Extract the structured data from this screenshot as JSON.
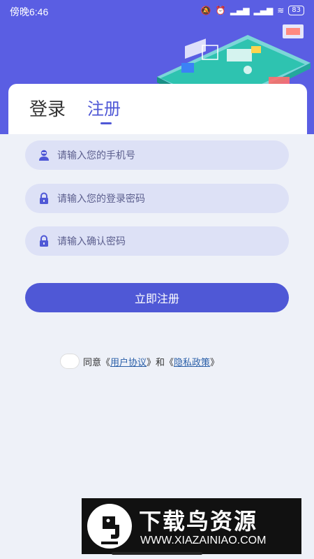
{
  "status_bar": {
    "time": "傍晚6:46",
    "battery": "83",
    "icons": [
      "alarm-off-icon",
      "alarm-icon",
      "hd-signal-icon",
      "hd-signal-icon",
      "wifi-icon",
      "battery-icon"
    ]
  },
  "tabs": {
    "login": "登录",
    "register": "注册",
    "active": "register"
  },
  "form": {
    "phone_placeholder": "请输入您的手机号",
    "password_placeholder": "请输入您的登录密码",
    "confirm_placeholder": "请输入确认密码",
    "submit_label": "立即注册"
  },
  "agreement": {
    "prefix": "同意《",
    "user_agreement": "用户协议",
    "mid": "》和《",
    "privacy_policy": "隐私政策",
    "suffix": "》"
  },
  "watermark": {
    "title": "下载鸟资源",
    "url": "WWW.XIAZAINIAO.COM"
  },
  "colors": {
    "primary": "#4f58d6",
    "header_bg": "#5a5ee3",
    "field_bg": "#dde1f6",
    "page_bg": "#eef1f8"
  }
}
